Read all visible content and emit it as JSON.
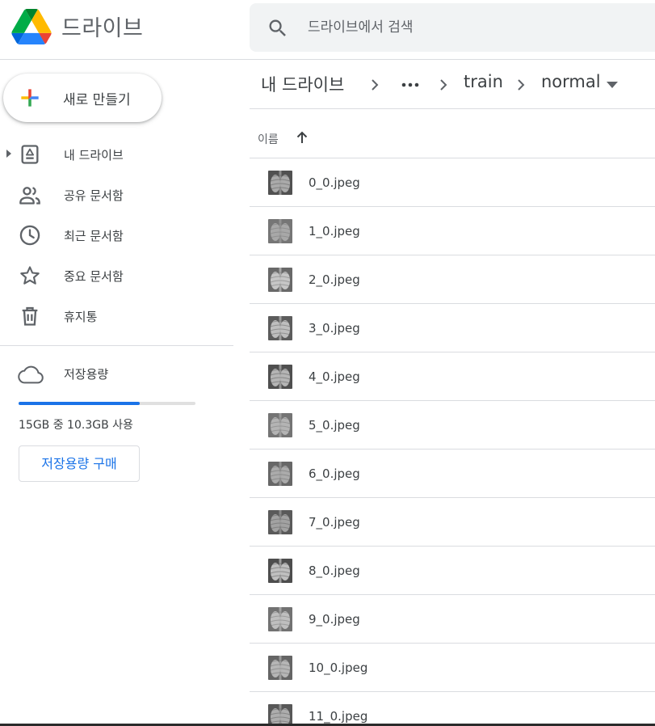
{
  "header": {
    "app_title": "드라이브",
    "search_placeholder": "드라이브에서 검색"
  },
  "sidebar": {
    "new_button_label": "새로 만들기",
    "items": [
      {
        "label": "내 드라이브",
        "icon": "my-drive-icon"
      },
      {
        "label": "공유 문서함",
        "icon": "shared-people-icon"
      },
      {
        "label": "최근 문서함",
        "icon": "clock-icon"
      },
      {
        "label": "중요 문서함",
        "icon": "star-icon"
      },
      {
        "label": "휴지통",
        "icon": "trash-icon"
      }
    ],
    "storage": {
      "label": "저장용량",
      "usage_text": "15GB 중 10.3GB 사용",
      "used_fraction": 0.687,
      "buy_button_label": "저장용량 구매"
    }
  },
  "breadcrumb": {
    "items": [
      "내 드라이브",
      "train",
      "normal"
    ],
    "overflow_icon": "more-horiz-icon"
  },
  "file_list": {
    "column_name": "이름",
    "sort": "ascending",
    "files": [
      "0_0.jpeg",
      "1_0.jpeg",
      "2_0.jpeg",
      "3_0.jpeg",
      "4_0.jpeg",
      "5_0.jpeg",
      "6_0.jpeg",
      "7_0.jpeg",
      "8_0.jpeg",
      "9_0.jpeg",
      "10_0.jpeg",
      "11_0.jpeg"
    ]
  },
  "colors": {
    "accent": "#1a73e8",
    "divider": "#dadce0",
    "search_bg": "#f1f3f4",
    "text": "#3c4043"
  }
}
